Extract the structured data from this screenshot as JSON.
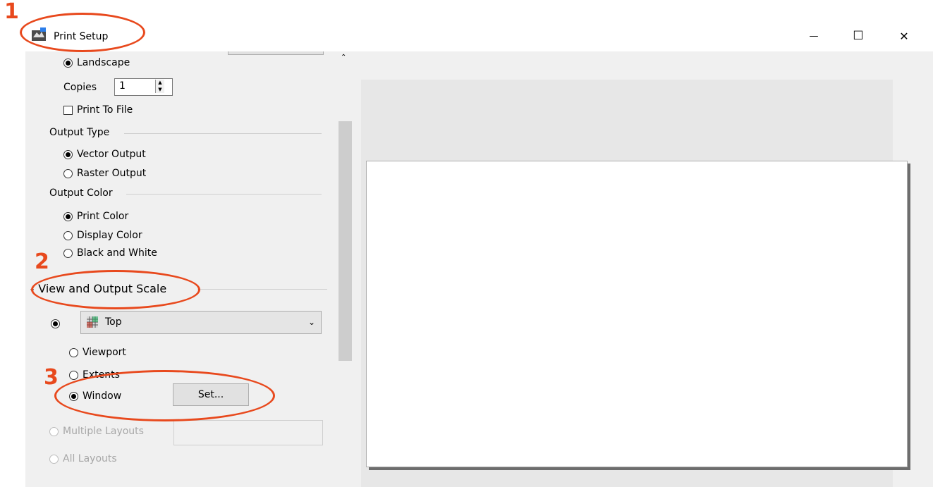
{
  "window": {
    "title": "Print Setup",
    "controls": {
      "minimize": "—",
      "maximize": "☐",
      "close": "✕"
    }
  },
  "orientation": {
    "landscape_label": "Landscape",
    "landscape_selected": true
  },
  "copies": {
    "label": "Copies",
    "value": "1"
  },
  "print_to_file": {
    "label": "Print To File",
    "checked": false
  },
  "output_type": {
    "heading": "Output Type",
    "options": [
      {
        "label": "Vector Output",
        "selected": true
      },
      {
        "label": "Raster Output",
        "selected": false
      }
    ]
  },
  "output_color": {
    "heading": "Output Color",
    "options": [
      {
        "label": "Print Color",
        "selected": true
      },
      {
        "label": "Display Color",
        "selected": false
      },
      {
        "label": "Black and White",
        "selected": false
      }
    ]
  },
  "view_and_output_scale": {
    "heading": "View and Output Scale",
    "view_dropdown": {
      "value": "Top",
      "icon": "viewport-grid-icon"
    },
    "area_options": [
      {
        "label": "Viewport",
        "selected": false
      },
      {
        "label": "Extents",
        "selected": false
      },
      {
        "label": "Window",
        "selected": true
      }
    ],
    "set_button": "Set...",
    "multiple_layouts": "Multiple Layouts",
    "all_layouts": "All Layouts"
  },
  "annotations": {
    "callout_1": "1",
    "callout_2": "2",
    "callout_3": "3",
    "color": "#e8491d"
  }
}
